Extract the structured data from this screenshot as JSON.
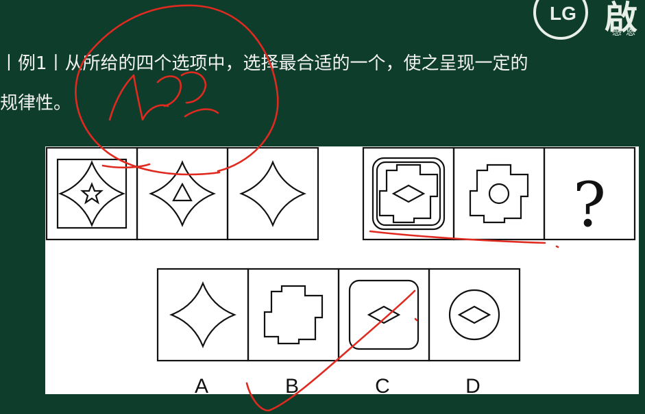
{
  "brand": {
    "logo_letters": "LG",
    "name_big": "啟",
    "name_small": "感恩"
  },
  "question": {
    "line1": "丨例1丨从所给的四个选项中，选择最合适的一个，使之呈现一定的",
    "line2": "规律性。"
  },
  "puzzle": {
    "group1": [
      "framed-star-in-four-point-shape",
      "triangle-in-four-point-shape",
      "four-point-shape"
    ],
    "group2": [
      "diamond-in-cross-in-rounded-square",
      "circle-in-cross",
      "question-mark"
    ],
    "question_mark": "?"
  },
  "options": {
    "labels": [
      "A",
      "B",
      "C",
      "D"
    ],
    "shapes": [
      "four-point-shape",
      "cross-shape",
      "diamond-in-rounded-square",
      "diamond-in-circle"
    ]
  },
  "colors": {
    "background": "#0f3d2c",
    "panel": "#ffffff",
    "stroke": "#111111",
    "annotation": "#e02a1f"
  }
}
